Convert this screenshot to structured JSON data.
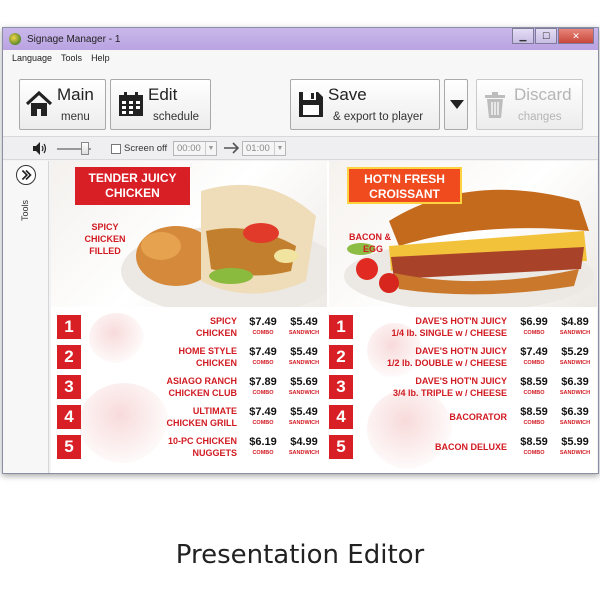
{
  "window": {
    "title": "Signage Manager - 1"
  },
  "window_controls": {
    "minimize": "▁",
    "maximize": "☐",
    "close": "✕"
  },
  "menu": [
    "Language",
    "Tools",
    "Help"
  ],
  "toolbar": {
    "main": {
      "big": "Main",
      "small": "menu",
      "icon": "home-icon"
    },
    "edit": {
      "big": "Edit",
      "small": "schedule",
      "icon": "calendar-icon"
    },
    "save": {
      "big": "Save",
      "small": "& export to player",
      "icon": "floppy-disk-icon"
    },
    "save_dropdown": {
      "icon": "triangle-down-icon"
    },
    "discard": {
      "big": "Discard",
      "small": "changes",
      "icon": "trash-icon",
      "enabled": false
    }
  },
  "playback": {
    "volume_icon": "speaker-icon",
    "volume_level": 0.75,
    "screen_off_label": "Screen off",
    "screen_off_checked": false,
    "time_from": "00:00",
    "time_to": "01:00"
  },
  "sidebar": {
    "tools_label": "Tools",
    "toggle_icon": "chevron-right-circle-icon"
  },
  "board": {
    "left": {
      "title_line1": "TENDER JUICY",
      "title_line2": "CHICKEN",
      "desc": [
        "SPICY",
        "CHICKEN",
        "FILLED"
      ],
      "items": [
        {
          "num": "1",
          "name": [
            "SPICY",
            "CHICKEN"
          ],
          "combo": "$7.49",
          "sandwich": "$5.49"
        },
        {
          "num": "2",
          "name": [
            "HOME STYLE",
            "CHICKEN"
          ],
          "combo": "$7.49",
          "sandwich": "$5.49"
        },
        {
          "num": "3",
          "name": [
            "ASIAGO RANCH",
            "CHICKEN CLUB"
          ],
          "combo": "$7.89",
          "sandwich": "$5.69"
        },
        {
          "num": "4",
          "name": [
            "ULTIMATE",
            "CHICKEN GRILL"
          ],
          "combo": "$7.49",
          "sandwich": "$5.49"
        },
        {
          "num": "5",
          "name": [
            "10-PC CHICKEN",
            "NUGGETS"
          ],
          "combo": "$6.19",
          "sandwich": "$4.99"
        }
      ]
    },
    "right": {
      "title_line1": "HOT'N FRESH",
      "title_line2": "CROISSANT",
      "desc": [
        "BACON &",
        "EGG"
      ],
      "items": [
        {
          "num": "1",
          "name": [
            "DAVE'S HOT'N JUICY",
            "1/4 lb. SINGLE w / CHEESE"
          ],
          "combo": "$6.99",
          "sandwich": "$4.89"
        },
        {
          "num": "2",
          "name": [
            "DAVE'S HOT'N JUICY",
            "1/2 lb. DOUBLE w / CHEESE"
          ],
          "combo": "$7.49",
          "sandwich": "$5.29"
        },
        {
          "num": "3",
          "name": [
            "DAVE'S HOT'N JUICY",
            "3/4 lb. TRIPLE w / CHEESE"
          ],
          "combo": "$8.59",
          "sandwich": "$6.39"
        },
        {
          "num": "4",
          "name": [
            "BACORATOR",
            ""
          ],
          "combo": "$8.59",
          "sandwich": "$6.39"
        },
        {
          "num": "5",
          "name": [
            "BACON DELUXE",
            ""
          ],
          "combo": "$8.59",
          "sandwich": "$5.99"
        }
      ]
    },
    "combo_label": "COMBO",
    "sandwich_label": "SANDWICH"
  },
  "caption": "Presentation Editor",
  "colors": {
    "accent_red": "#d91f26",
    "accent_orange": "#f04a1f",
    "titlebar": "#c2b0e7"
  }
}
